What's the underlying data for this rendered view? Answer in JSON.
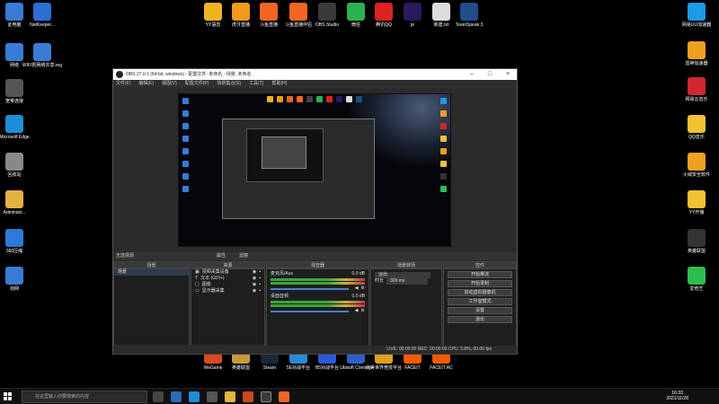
{
  "desktop": {
    "top_icons": [
      {
        "label": "YY语音",
        "color": "#f2b320"
      },
      {
        "label": "虎牙直播",
        "color": "#f09a1a"
      },
      {
        "label": "斗鱼直播",
        "color": "#f26522"
      },
      {
        "label": "斗鱼直播伴侣",
        "color": "#f26522"
      },
      {
        "label": "OBS Studio",
        "color": "#3a3a3a"
      },
      {
        "label": "微信",
        "color": "#2bb24c"
      },
      {
        "label": "腾讯QQ",
        "color": "#d22"
      },
      {
        "label": "pr",
        "color": "#2a1a5e"
      },
      {
        "label": "新建.txt",
        "color": "#ddd"
      },
      {
        "label": "TeamSpeak 3",
        "color": "#1f4e8c"
      }
    ],
    "left_icons": [
      {
        "label": "此电脑",
        "color": "#3a7bd5"
      },
      {
        "label": "网络",
        "color": "#3a7bd5"
      },
      {
        "label": "宽带连接",
        "color": "#555"
      },
      {
        "label": "Microsoft Edge",
        "color": "#1d8fd6"
      },
      {
        "label": "回收站",
        "color": "#888"
      },
      {
        "label": "Administr...",
        "color": "#e3b341"
      },
      {
        "label": "360压缩",
        "color": "#2d7bd6"
      },
      {
        "label": "剑网",
        "color": "#3a7bd5"
      }
    ],
    "second_col_icons": [
      {
        "label": "NetKeeper...",
        "color": "#2b6ed6"
      },
      {
        "label": "WIFI把网络共享.reg",
        "color": "#3a7bd5"
      }
    ],
    "right_icons": [
      {
        "label": "网易UU加速器",
        "color": "#1c9be6"
      },
      {
        "label": "雷神加速器",
        "color": "#f0a020"
      },
      {
        "label": "网易云音乐",
        "color": "#d0282e"
      },
      {
        "label": "QQ音乐",
        "color": "#f2c230"
      },
      {
        "label": "火绒安全软件",
        "color": "#f0a020"
      },
      {
        "label": "YY开播",
        "color": "#f2c230"
      },
      {
        "label": "英雄联盟",
        "color": "#333"
      },
      {
        "label": "爱奇艺",
        "color": "#2ebd4c"
      }
    ],
    "bottom_icons": [
      {
        "label": "WeGame",
        "color": "#d84a1e"
      },
      {
        "label": "英雄联盟",
        "color": "#c79b3a"
      },
      {
        "label": "Steam",
        "color": "#1b2838"
      },
      {
        "label": "5E对战平台",
        "color": "#2a8ad6"
      },
      {
        "label": "B5对战平台",
        "color": "#2a5ad6"
      },
      {
        "label": "Ubisoft Connect",
        "color": "#2a62c9"
      },
      {
        "label": "完美世界竞技平台",
        "color": "#e0a020"
      },
      {
        "label": "FACEIT",
        "color": "#f35a00"
      },
      {
        "label": "FACEIT AC",
        "color": "#f35a00"
      }
    ]
  },
  "obs": {
    "title": "OBS 27.0.1 (64-bit, windows) - 配置文件: 未命名 - 场景: 未命名",
    "menu": [
      "文件(F)",
      "编辑(E)",
      "视图(V)",
      "配置文件(P)",
      "场景集合(S)",
      "工具(T)",
      "帮助(H)"
    ],
    "status_strip": "无选择源",
    "status_strip_buttons": [
      "属性",
      "滤镜"
    ],
    "docks": {
      "scenes": {
        "title": "场景",
        "items": [
          "场景"
        ]
      },
      "sources": {
        "title": "来源",
        "items": [
          "视频采集设备",
          "文本 (GDI+)",
          "图像",
          "显示器采集"
        ]
      },
      "mixer": {
        "title": "混音器",
        "channels": [
          {
            "name": "麦克风/Aux",
            "db": "0.0 dB"
          },
          {
            "name": "桌面音频",
            "db": "0.0 dB"
          }
        ]
      },
      "transitions": {
        "title": "场景转场",
        "type": "淡出",
        "duration_label": "时长",
        "duration": "300 ms"
      },
      "controls": {
        "title": "控件",
        "buttons": [
          "开始推流",
          "开始录制",
          "启动虚拟摄像机",
          "工作室模式",
          "设置",
          "退出"
        ]
      }
    },
    "statusbar": "LIVE: 00:00:00    REC: 00:00:00    CPU: 5.8%, 60.00 fps"
  },
  "taskbar": {
    "search_placeholder": "在这里输入你要搜索的内容",
    "time": "16:33",
    "date": "2021/11/28"
  }
}
